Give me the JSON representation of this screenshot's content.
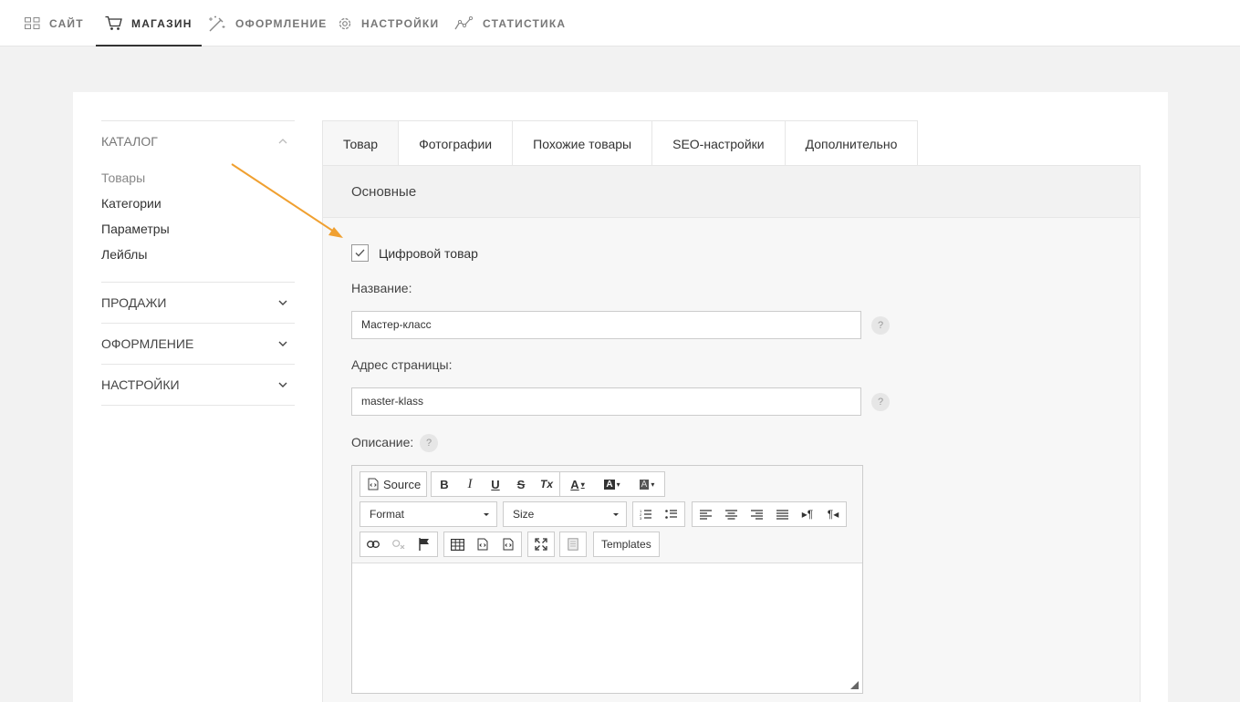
{
  "topnav": {
    "items": [
      {
        "label": "САЙТ",
        "icon": "grid-icon"
      },
      {
        "label": "МАГАЗИН",
        "icon": "cart-icon",
        "active": true
      },
      {
        "label": "ОФОРМЛЕНИЕ",
        "icon": "magic-wand-icon"
      },
      {
        "label": "НАСТРОЙКИ",
        "icon": "gear-icon"
      },
      {
        "label": "СТАТИСТИКА",
        "icon": "chart-line-icon"
      }
    ]
  },
  "sidebar": {
    "catalog": {
      "title": "КАТАЛОГ",
      "items": [
        "Товары",
        "Категории",
        "Параметры",
        "Лейблы"
      ]
    },
    "sections": [
      "ПРОДАЖИ",
      "ОФОРМЛЕНИЕ",
      "НАСТРОЙКИ"
    ]
  },
  "tabs": [
    "Товар",
    "Фотографии",
    "Похожие товары",
    "SEO-настройки",
    "Дополнительно"
  ],
  "panel": {
    "title": "Основные",
    "digital_checkbox": {
      "label": "Цифровой товар",
      "checked": true
    },
    "name": {
      "label": "Название:",
      "value": "Мастер-класс"
    },
    "address": {
      "label": "Адрес страницы:",
      "value": "master-klass"
    },
    "description": {
      "label": "Описание:"
    },
    "help_symbol": "?"
  },
  "editor": {
    "source_label": "Source",
    "format_label": "Format",
    "size_label": "Size",
    "templates_label": "Templates",
    "bold": "B",
    "italic": "I",
    "underline": "U",
    "strike": "S",
    "clear_format": "Tx",
    "text_color": "A",
    "bg_color": "A",
    "ltr": "▸¶",
    "rtl": "¶◂"
  },
  "colors": {
    "accent": "#f0a030"
  }
}
